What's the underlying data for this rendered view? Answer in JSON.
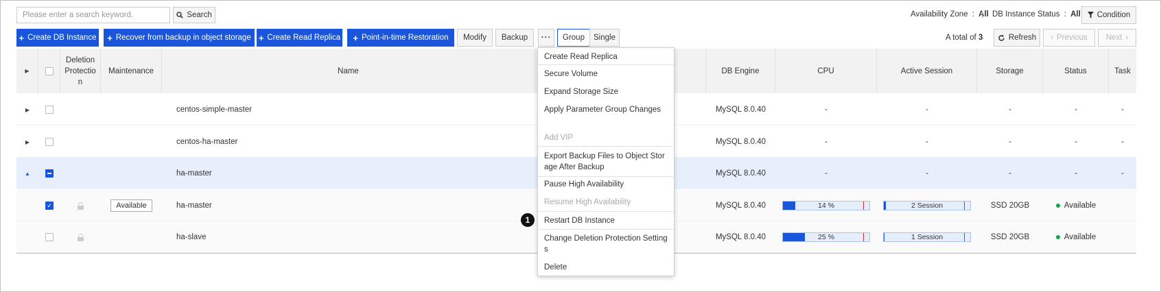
{
  "search": {
    "placeholder": "Please enter a search keyword.",
    "button_label": "Search"
  },
  "filters": {
    "availability_zone_label": "Availability Zone",
    "availability_zone_value": "All",
    "status_label": "DB Instance Status",
    "status_value": "All",
    "separator": ":",
    "condition_label": "Condition"
  },
  "toolbar": {
    "create_db_instance": "Create DB Instance",
    "recover_from_backup": "Recover from backup in object storage",
    "create_read_replica": "Create Read Replica",
    "point_in_time": "Point-in-time Restoration",
    "modify": "Modify",
    "backup": "Backup",
    "more": "···",
    "group": "Group",
    "single": "Single"
  },
  "pagination": {
    "total_prefix": "A total of",
    "total_count": "3",
    "refresh": "Refresh",
    "previous": "Previous",
    "next": "Next"
  },
  "table": {
    "headers": {
      "deletion_protection": "Deletion Protection",
      "maintenance": "Maintenance",
      "name": "Name",
      "db_engine": "DB Engine",
      "cpu": "CPU",
      "active_session": "Active Session",
      "storage": "Storage",
      "status": "Status",
      "task": "Task"
    },
    "rows": [
      {
        "name": "centos-simple-master",
        "db_engine": "MySQL 8.0.40",
        "cpu": "-",
        "active_session": "-",
        "storage": "-",
        "status": "-",
        "task": "-"
      },
      {
        "name": "centos-ha-master",
        "db_engine": "MySQL 8.0.40",
        "cpu": "-",
        "active_session": "-",
        "storage": "-",
        "status": "-",
        "task": "-"
      },
      {
        "name": "ha-master",
        "db_engine": "MySQL 8.0.40",
        "cpu": "-",
        "active_session": "-",
        "storage": "-",
        "status": "-",
        "task": "-"
      },
      {
        "name": "ha-master",
        "maintenance": "Available",
        "db_engine": "MySQL 8.0.40",
        "cpu_label": "14 %",
        "cpu_percent": 14,
        "session_label": "2 Session",
        "session_fraction": 0.02,
        "storage": "SSD 20GB",
        "status": "Available"
      },
      {
        "name": "ha-slave",
        "db_engine": "MySQL 8.0.40",
        "cpu_label": "25 %",
        "cpu_percent": 25,
        "session_label": "1 Session",
        "session_fraction": 0.01,
        "storage": "SSD 20GB",
        "status": "Available"
      }
    ]
  },
  "menu": {
    "items": [
      {
        "label": "Create Read Replica",
        "disabled": false
      },
      {
        "label": "Secure Volume",
        "disabled": false
      },
      {
        "label": "Expand Storage Size",
        "disabled": false
      },
      {
        "label": "Apply Parameter Group Changes",
        "disabled": false
      },
      {
        "label": "Add VIP",
        "disabled": true
      },
      {
        "label": "Export Backup Files to Object Storage After Backup",
        "disabled": false
      },
      {
        "label": "Pause High Availability",
        "disabled": false
      },
      {
        "label": "Resume High Availability",
        "disabled": true
      },
      {
        "label": "Restart DB Instance",
        "disabled": false
      },
      {
        "label": "Change Deletion Protection Settings",
        "disabled": false
      },
      {
        "label": "Delete",
        "disabled": false
      }
    ]
  },
  "annotation": {
    "marker": "1"
  },
  "colors": {
    "primary": "#1a56db",
    "selected_row": "#e8effc",
    "status_ok": "#16a34a",
    "threshold": "#d0312d"
  },
  "icons": {
    "search": "search-icon",
    "condition": "filter-icon",
    "refresh": "refresh-icon",
    "previous": "chevron-left-icon",
    "next": "chevron-right-icon",
    "expand": "caret-right-icon",
    "collapse": "caret-up-icon",
    "lock": "lock-icon",
    "status": "status-dot-icon"
  }
}
